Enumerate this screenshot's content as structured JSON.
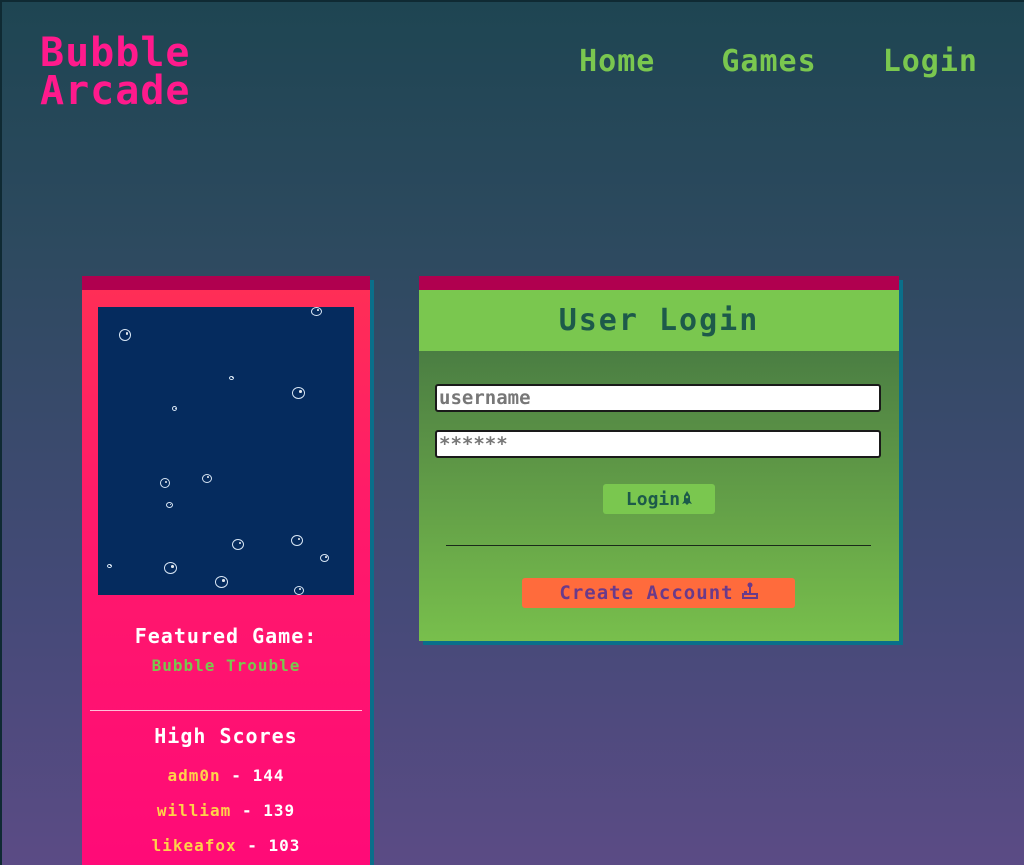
{
  "site": {
    "logo_line1": "Bubble",
    "logo_line2": "Arcade"
  },
  "nav": {
    "home": "Home",
    "games": "Games",
    "login": "Login"
  },
  "featured": {
    "title": "Featured Game:",
    "game_name": "Bubble Trouble"
  },
  "high_scores": {
    "title": "High Scores",
    "entries": [
      {
        "name": "adm0n",
        "separator": " - ",
        "score": "144"
      },
      {
        "name": "william",
        "separator": " - ",
        "score": "139"
      },
      {
        "name": "likeafox",
        "separator": " - ",
        "score": "103"
      }
    ]
  },
  "login": {
    "title": "User Login",
    "username_placeholder": "username",
    "password_placeholder": "******",
    "submit_label": "Login",
    "submit_icon": "rocket-icon",
    "create_label": "Create Account",
    "create_icon": "joystick-icon"
  },
  "colors": {
    "logo": "#ff1a8c",
    "nav": "#7ac74f",
    "accent_bar": "#b0004f",
    "game_bg": "#052b5e",
    "create_button": "#ff6b3c"
  }
}
